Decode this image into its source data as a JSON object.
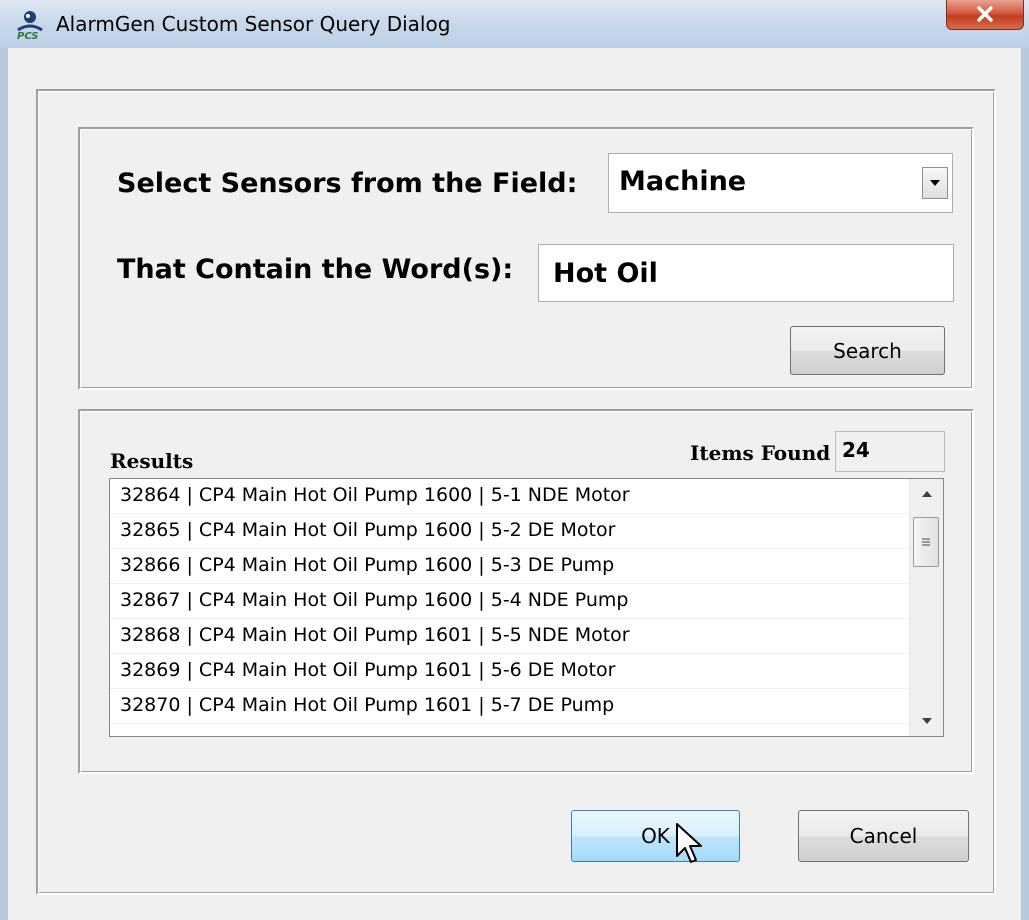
{
  "window": {
    "title": "AlarmGen Custom Sensor Query Dialog",
    "app_icon": "pcs-sensor-icon",
    "close_icon": "close-icon"
  },
  "query": {
    "field_label": "Select Sensors from the Field:",
    "field_value": "Machine",
    "contains_label": "That Contain the Word(s):",
    "contains_value": "Hot Oil",
    "search_label": "Search"
  },
  "results": {
    "label": "Results",
    "items_found_label": "Items Found",
    "items_found_value": "24",
    "items": [
      "32864 | CP4 Main Hot Oil Pump 1600 | 5-1 NDE Motor",
      "32865 | CP4 Main Hot Oil Pump 1600 | 5-2 DE Motor",
      "32866 | CP4 Main Hot Oil Pump 1600 | 5-3 DE Pump",
      "32867 | CP4 Main Hot Oil Pump 1600 | 5-4 NDE Pump",
      "32868 | CP4 Main Hot Oil Pump 1601 | 5-5 NDE Motor",
      "32869 | CP4 Main Hot Oil Pump 1601 | 5-6 DE Motor",
      "32870 | CP4 Main Hot Oil Pump 1601 | 5-7 DE Pump"
    ]
  },
  "buttons": {
    "ok_label": "OK",
    "cancel_label": "Cancel"
  },
  "colors": {
    "ok_button_accent": "#3c7fb1",
    "close_button": "#c33c20",
    "title_bar": "#c9d8ea"
  }
}
